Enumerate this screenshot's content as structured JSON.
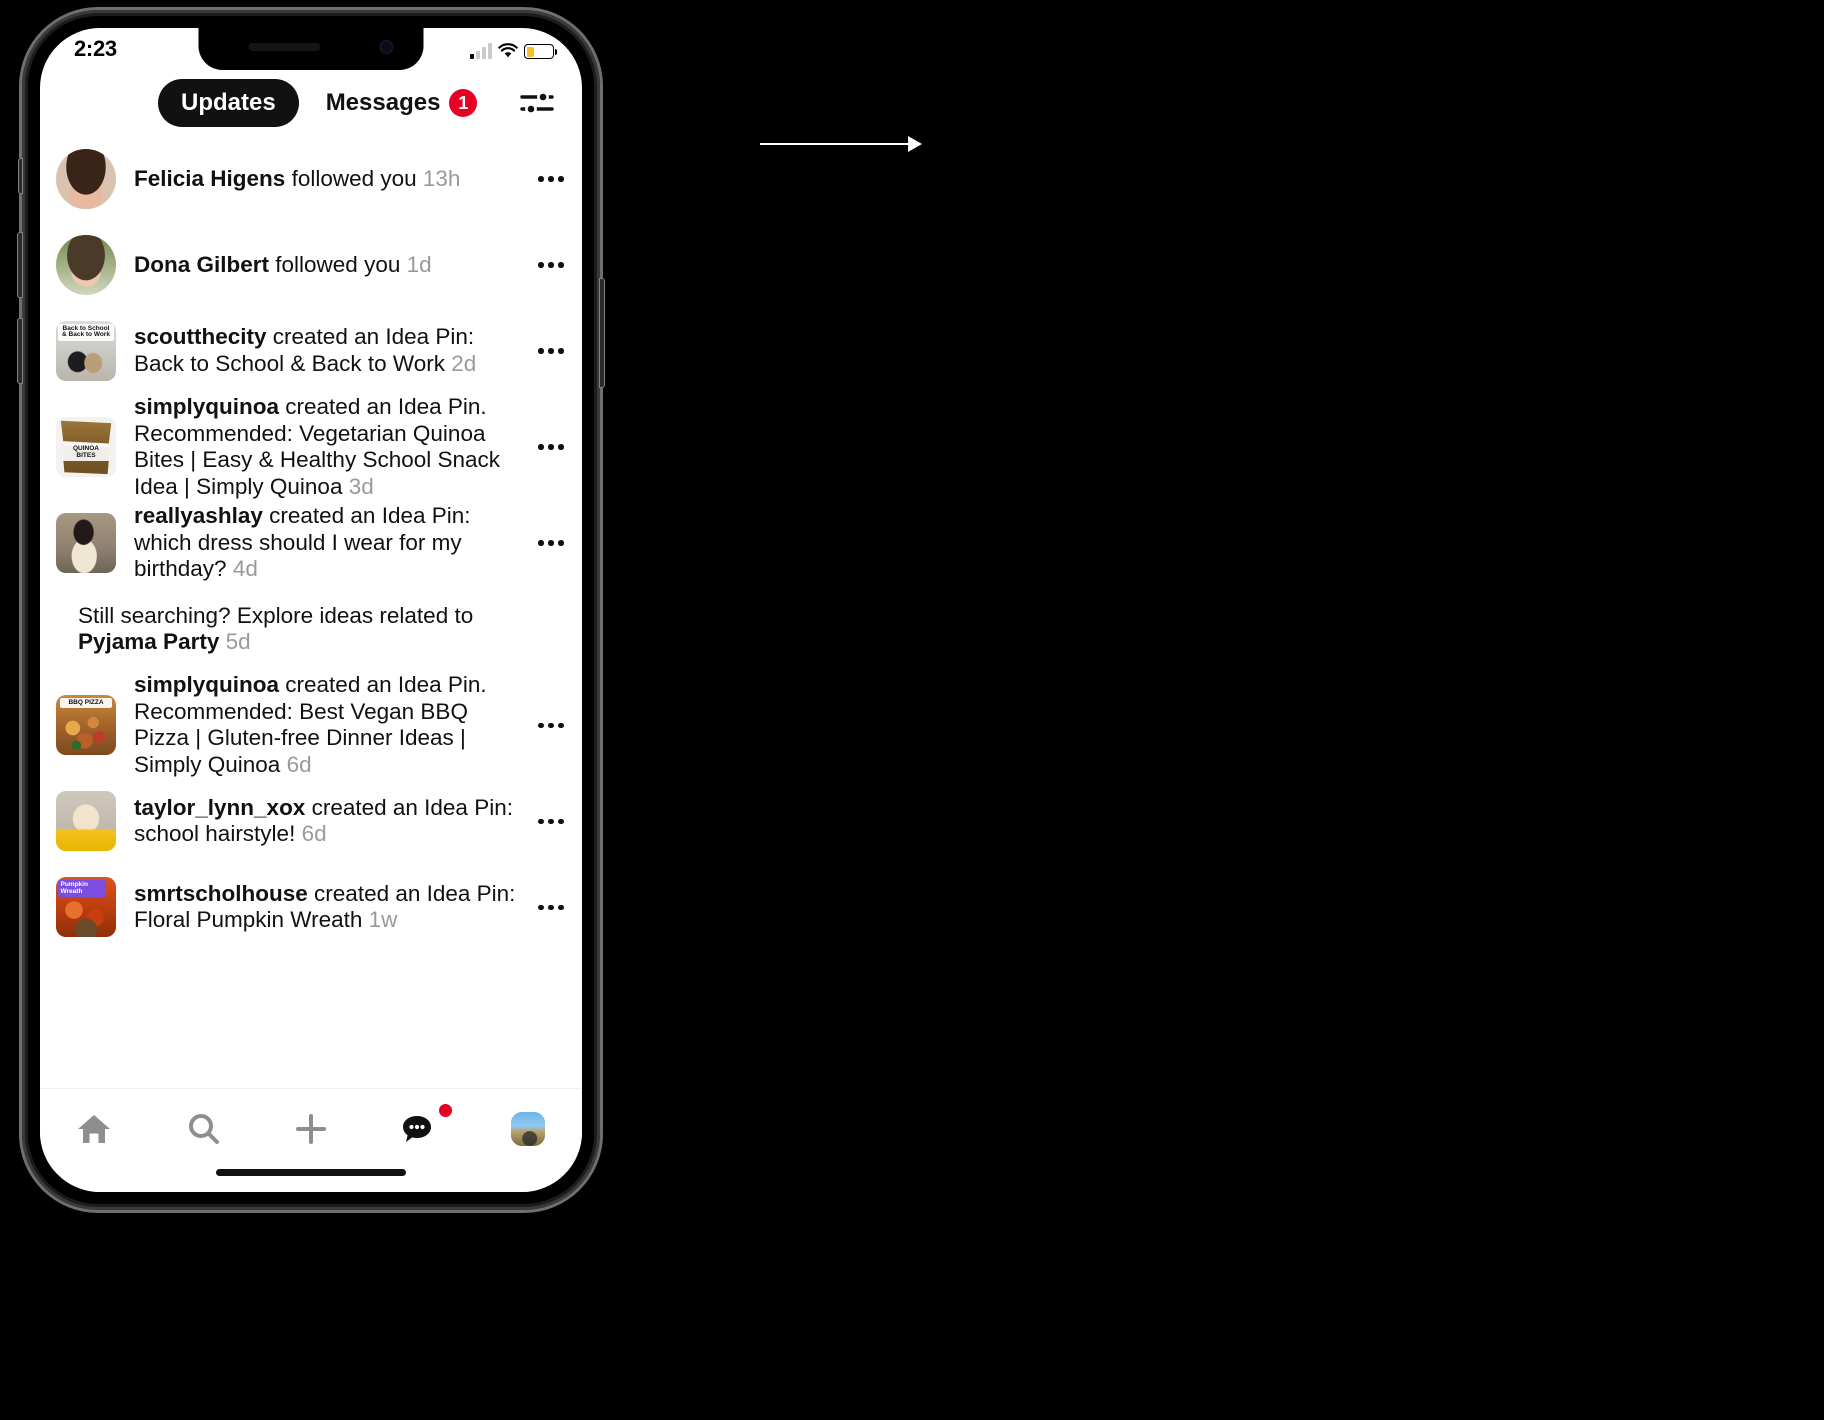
{
  "status_bar": {
    "time": "2:23",
    "signal_icon": "cellular-signal-icon",
    "wifi_icon": "wifi-icon",
    "battery_icon": "battery-low-icon",
    "battery_level_percent": 26
  },
  "header": {
    "tabs": [
      {
        "label": "Updates",
        "active": true,
        "badge": null
      },
      {
        "label": "Messages",
        "active": false,
        "badge": "1"
      }
    ],
    "filter_icon": "filter-sliders-icon"
  },
  "colors": {
    "accent_red": "#e60023",
    "active_tab_bg": "#111111",
    "timestamp_gray": "#9a9a9a",
    "battery_yellow": "#f3c12a"
  },
  "feed": {
    "items": [
      {
        "media_type": "avatar",
        "media_name": "avatar-felicia-higens",
        "actor": "Felicia Higens",
        "action": " followed you ",
        "time": "13h",
        "more_label": "more-options"
      },
      {
        "media_type": "avatar",
        "media_name": "avatar-dona-gilbert",
        "actor": "Dona Gilbert",
        "action": " followed you ",
        "time": "1d",
        "more_label": "more-options"
      },
      {
        "media_type": "pin",
        "media_name": "pin-thumbnail-back-to-school",
        "media_caption": "Back to School & Back to Work",
        "actor": "scoutthecity",
        "action": " created an Idea Pin: Back to School &  Back to Work ",
        "time": "2d",
        "more_label": "more-options"
      },
      {
        "media_type": "pin",
        "media_name": "pin-thumbnail-quinoa-bites",
        "media_caption": "QUINOA BITES",
        "actor": "simplyquinoa",
        "action": " created an Idea Pin. Recommended: Vegetarian Quinoa Bites | Easy & Healthy School Snack Idea | Simply Quinoa ",
        "time": "3d",
        "more_label": "more-options"
      },
      {
        "media_type": "pin",
        "media_name": "pin-thumbnail-dress",
        "media_caption": "",
        "actor": "reallyashlay",
        "action": " created an Idea Pin: which dress should I wear for my birthday? ",
        "time": "4d",
        "more_label": "more-options"
      },
      {
        "media_type": "none",
        "media_name": "no-thumbnail",
        "prefix": "Still searching? Explore ideas related to ",
        "actor": "Pyjama Party",
        "actor_position": "end",
        "action": " ",
        "time": "5d",
        "more_label": null
      },
      {
        "media_type": "pin",
        "media_name": "pin-thumbnail-bbq-pizza",
        "media_caption": "BBQ PIZZA",
        "actor": "simplyquinoa",
        "action": " created an Idea Pin. Recommended: Best Vegan BBQ Pizza | Gluten-free Dinner Ideas | Simply Quinoa ",
        "time": "6d",
        "more_label": "more-options"
      },
      {
        "media_type": "pin",
        "media_name": "pin-thumbnail-school-hairstyle",
        "media_caption": "",
        "actor": "taylor_lynn_xox",
        "action": " created an Idea Pin: school hairstyle! ",
        "time": "6d",
        "more_label": "more-options"
      },
      {
        "media_type": "pin",
        "media_name": "pin-thumbnail-pumpkin-wreath",
        "media_caption": "Pumpkin Wreath",
        "actor": "smrtscholhouse",
        "action": " created an Idea Pin: Floral Pumpkin Wreath ",
        "time": "1w",
        "more_label": "more-options"
      }
    ]
  },
  "bottom_nav": {
    "items": [
      {
        "icon": "home-icon",
        "active": false,
        "badge": false
      },
      {
        "icon": "search-icon",
        "active": false,
        "badge": false
      },
      {
        "icon": "plus-icon",
        "active": false,
        "badge": false
      },
      {
        "icon": "chat-bubble-icon",
        "active": true,
        "badge": true
      },
      {
        "icon": "profile-avatar-icon",
        "active": false,
        "badge": false
      }
    ]
  }
}
